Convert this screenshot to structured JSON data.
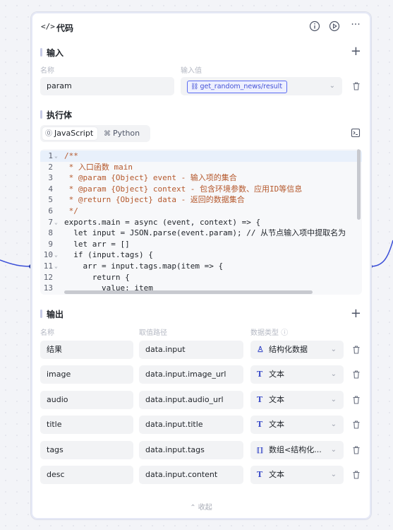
{
  "node": {
    "title": "代码"
  },
  "input_section": {
    "title": "输入",
    "col_name": "名称",
    "col_value": "输入值",
    "row": {
      "name": "param",
      "ref": "get_random_news/result"
    }
  },
  "exec_section": {
    "title": "执行体",
    "tabs": [
      {
        "label": "JavaScript",
        "active": true
      },
      {
        "label": "Python",
        "active": false
      }
    ]
  },
  "code": {
    "lines": [
      {
        "n": "1",
        "fold": true,
        "text": "/**"
      },
      {
        "n": "2",
        "fold": false,
        "text": " * 入口函数 main"
      },
      {
        "n": "3",
        "fold": false,
        "text": " * @param {Object} event - 输入项的集合"
      },
      {
        "n": "4",
        "fold": false,
        "text": " * @param {Object} context - 包含环境参数、应用ID等信息"
      },
      {
        "n": "5",
        "fold": false,
        "text": " * @return {Object} data - 返回的数据集合"
      },
      {
        "n": "6",
        "fold": false,
        "text": " */"
      },
      {
        "n": "7",
        "fold": true,
        "text": "exports.main = async (event, context) => {"
      },
      {
        "n": "8",
        "fold": false,
        "text": "  let input = JSON.parse(event.param); // 从节点输入项中提取名为"
      },
      {
        "n": "9",
        "fold": false,
        "text": "  let arr = []"
      },
      {
        "n": "10",
        "fold": true,
        "text": "  if (input.tags) {"
      },
      {
        "n": "11",
        "fold": true,
        "text": "    arr = input.tags.map(item => {"
      },
      {
        "n": "12",
        "fold": false,
        "text": "      return {"
      },
      {
        "n": "13",
        "fold": false,
        "text": "        value: item"
      }
    ]
  },
  "output_section": {
    "title": "输出",
    "col_name": "名称",
    "col_path": "取值路径",
    "col_type": "数据类型",
    "rows": [
      {
        "name": "结果",
        "path": "data.input",
        "type": "结构化数据",
        "icon": "object-icon"
      },
      {
        "name": "image",
        "path": "data.input.image_url",
        "type": "文本",
        "icon": "text-icon"
      },
      {
        "name": "audio",
        "path": "data.input.audio_url",
        "type": "文本",
        "icon": "text-icon"
      },
      {
        "name": "title",
        "path": "data.input.title",
        "type": "文本",
        "icon": "text-icon"
      },
      {
        "name": "tags",
        "path": "data.input.tags",
        "type": "数组<结构化...",
        "icon": "array-icon"
      },
      {
        "name": "desc",
        "path": "data.input.content",
        "type": "文本",
        "icon": "text-icon"
      }
    ]
  },
  "footer": {
    "collapse_label": "收起"
  },
  "colors": {
    "accent": "#3b4fd8",
    "edge": "#3b4fd8"
  }
}
